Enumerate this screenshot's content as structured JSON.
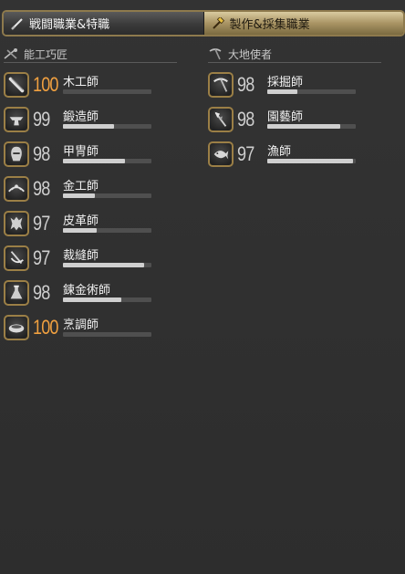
{
  "tabs": [
    {
      "label": "戦闘職業&特職",
      "icon": "sword-icon",
      "active": false
    },
    {
      "label": "製作&採集職業",
      "icon": "hammer-icon",
      "active": true
    }
  ],
  "crafters": {
    "header": "能工巧匠",
    "icon": "crafting-tools-icon",
    "jobs": [
      {
        "name": "木工師",
        "level": "100",
        "max": true,
        "progress": 0,
        "icon": "carpenter-saw-icon"
      },
      {
        "name": "鍛造師",
        "level": "99",
        "max": false,
        "progress": 0.58,
        "icon": "blacksmith-anvil-icon"
      },
      {
        "name": "甲冑師",
        "level": "98",
        "max": false,
        "progress": 0.7,
        "icon": "armorer-helmet-icon"
      },
      {
        "name": "金工師",
        "level": "98",
        "max": false,
        "progress": 0.36,
        "icon": "goldsmith-tiara-icon"
      },
      {
        "name": "皮革師",
        "level": "97",
        "max": false,
        "progress": 0.38,
        "icon": "leatherworker-hide-icon"
      },
      {
        "name": "裁縫師",
        "level": "97",
        "max": false,
        "progress": 0.92,
        "icon": "weaver-thread-icon"
      },
      {
        "name": "鍊金術師",
        "level": "98",
        "max": false,
        "progress": 0.66,
        "icon": "alchemist-flask-icon"
      },
      {
        "name": "烹調師",
        "level": "100",
        "max": true,
        "progress": 0,
        "icon": "culinarian-pot-icon"
      }
    ]
  },
  "gatherers": {
    "header": "大地使者",
    "icon": "gathering-tools-icon",
    "jobs": [
      {
        "name": "採掘師",
        "level": "98",
        "max": false,
        "progress": 0.34,
        "icon": "miner-pickaxe-icon"
      },
      {
        "name": "園藝師",
        "level": "98",
        "max": false,
        "progress": 0.82,
        "icon": "botanist-hatchet-icon"
      },
      {
        "name": "漁師",
        "level": "97",
        "max": false,
        "progress": 0.97,
        "icon": "fisher-fish-icon"
      }
    ]
  },
  "colors": {
    "frame_gold": "#9b7f46",
    "max_level": "#f0a040",
    "bar_track": "#4f4f4f",
    "bar_fill": "#cfcfcf"
  }
}
